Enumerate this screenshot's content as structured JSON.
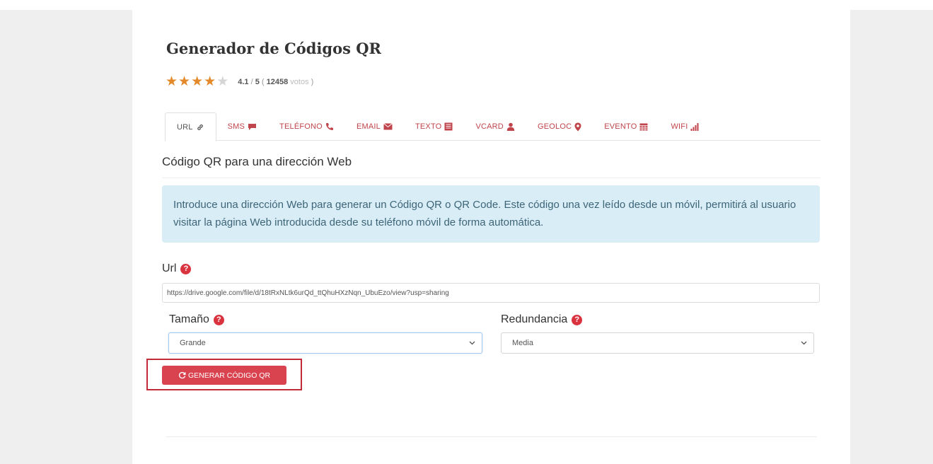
{
  "page": {
    "title": "Generador de Códigos QR",
    "rating": {
      "score": "4.1",
      "max": "5",
      "votes": "12458",
      "votes_label": "votos",
      "stars_value": 4.1,
      "stars_total": 5
    }
  },
  "tabs": [
    {
      "label": "URL",
      "icon": "link-icon",
      "active": true
    },
    {
      "label": "SMS",
      "icon": "comment-icon"
    },
    {
      "label": "TELÉFONO",
      "icon": "phone-icon"
    },
    {
      "label": "EMAIL",
      "icon": "envelope-icon"
    },
    {
      "label": "TEXTO",
      "icon": "text-file-icon"
    },
    {
      "label": "VCARD",
      "icon": "user-icon"
    },
    {
      "label": "GEOLOC",
      "icon": "map-marker-icon"
    },
    {
      "label": "EVENTO",
      "icon": "calendar-icon"
    },
    {
      "label": "WIFI",
      "icon": "signal-icon"
    }
  ],
  "section": {
    "title": "Código QR para una dirección Web",
    "info": "Introduce una dirección Web para generar un Código QR o QR Code. Este código una vez leído desde un móvil, permitirá al usuario visitar la página Web introducida desde su teléfono móvil de forma automática."
  },
  "form": {
    "url_label": "Url",
    "url_value": "https://drive.google.com/file/d/18tRxNLtk6urQd_ttQhuHXzNqn_UbuEzo/view?usp=sharing",
    "size_label": "Tamaño",
    "size_value": "Grande",
    "redundancy_label": "Redundancia",
    "redundancy_value": "Media",
    "generate_label": "GENERAR CÓDIGO QR"
  },
  "colors": {
    "accent": "#d9434f",
    "star": "#e4892a",
    "info_bg": "#d9edf7",
    "highlight": "#c12a37"
  }
}
